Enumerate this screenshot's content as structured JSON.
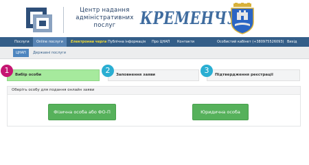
{
  "header": {
    "logo_line1": "Центр надання",
    "logo_line2": "адміністративних",
    "logo_line3": "послуг",
    "city_name": "КРЕМЕНЧУК",
    "logo_icon": "cnap-logo-icon",
    "coat_icon": "coat-of-arms-icon"
  },
  "nav": {
    "items": [
      {
        "label": "Послуги"
      },
      {
        "label": "Online послуги"
      },
      {
        "label": "Електронна черга"
      },
      {
        "label": "Публічна інформація"
      },
      {
        "label": "Про ЦНАП"
      },
      {
        "label": "Контакти"
      }
    ],
    "cabinet": "Особистий кабінет (+380975526093)",
    "logout": "Вихід"
  },
  "subnav": {
    "items": [
      {
        "label": "ЦНАП"
      },
      {
        "label": "Державні послуги"
      }
    ]
  },
  "steps": [
    {
      "number": "1",
      "label": "Вибір особи"
    },
    {
      "number": "2",
      "label": "Заповнення заяви"
    },
    {
      "number": "3",
      "label": "Підтвердження реєстрації"
    }
  ],
  "panel": {
    "title": "Оберіть особу для подання онлайн заяви",
    "individual_button": "Фізична особа або ФО-П",
    "legal_button": "Юридична особа"
  },
  "colors": {
    "nav_bg": "#345e88",
    "nav_active": "#5884b4",
    "nav_highlight": "#f4dd33",
    "step1_circle": "#c51672",
    "step_circle": "#2aaed2",
    "step_active_bg": "#a6ea9d",
    "button_green": "#56b15b"
  }
}
